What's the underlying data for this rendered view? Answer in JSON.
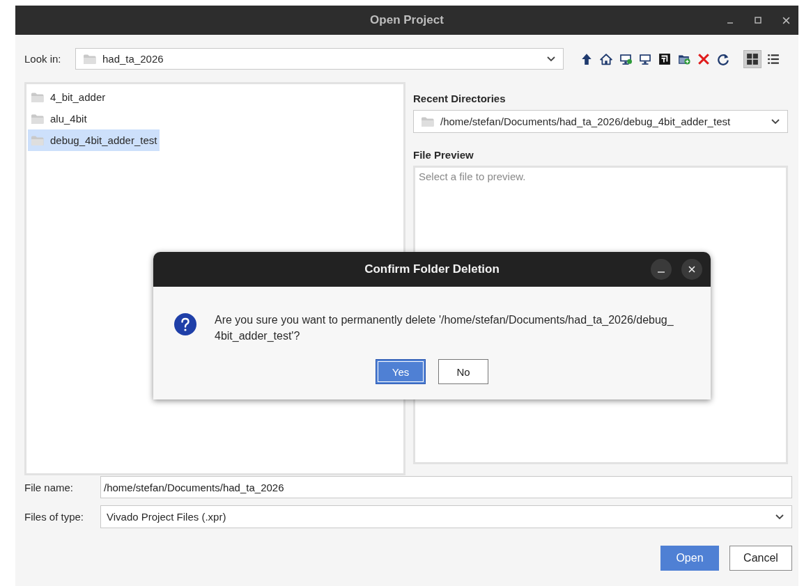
{
  "window": {
    "title": "Open Project"
  },
  "look_in": {
    "label": "Look in:",
    "value": "had_ta_2026"
  },
  "toolbar": [
    {
      "kind": "up"
    },
    {
      "kind": "home"
    },
    {
      "kind": "desktop-badge"
    },
    {
      "kind": "desktop"
    },
    {
      "kind": "logo"
    },
    {
      "kind": "new-folder"
    },
    {
      "kind": "delete"
    },
    {
      "kind": "refresh"
    }
  ],
  "view_modes": [
    {
      "kind": "grid",
      "selected": true
    },
    {
      "kind": "list",
      "selected": false
    }
  ],
  "folders": [
    {
      "name": "4_bit_adder",
      "selected": false
    },
    {
      "name": "alu_4bit",
      "selected": false
    },
    {
      "name": "debug_4bit_adder_test",
      "selected": true
    }
  ],
  "recent_directories": {
    "label": "Recent Directories",
    "value": "/home/stefan/Documents/had_ta_2026/debug_4bit_adder_test"
  },
  "file_preview": {
    "label": "File Preview",
    "placeholder": "Select a file to preview."
  },
  "file_name": {
    "label": "File name:",
    "value": "/home/stefan/Documents/had_ta_2026"
  },
  "file_type": {
    "label": "Files of type:",
    "value": "Vivado Project Files (.xpr)"
  },
  "buttons": [
    {
      "label": "Open",
      "primary": true
    },
    {
      "label": "Cancel",
      "primary": false
    }
  ],
  "confirm_dialog": {
    "title": "Confirm Folder Deletion",
    "message": "Are you sure you want to permanently delete '/home/stefan/Documents/had_ta_2026/debug_4bit_adder_test'?",
    "buttons": [
      {
        "label": "Yes",
        "default": true
      },
      {
        "label": "No",
        "default": false
      }
    ]
  }
}
